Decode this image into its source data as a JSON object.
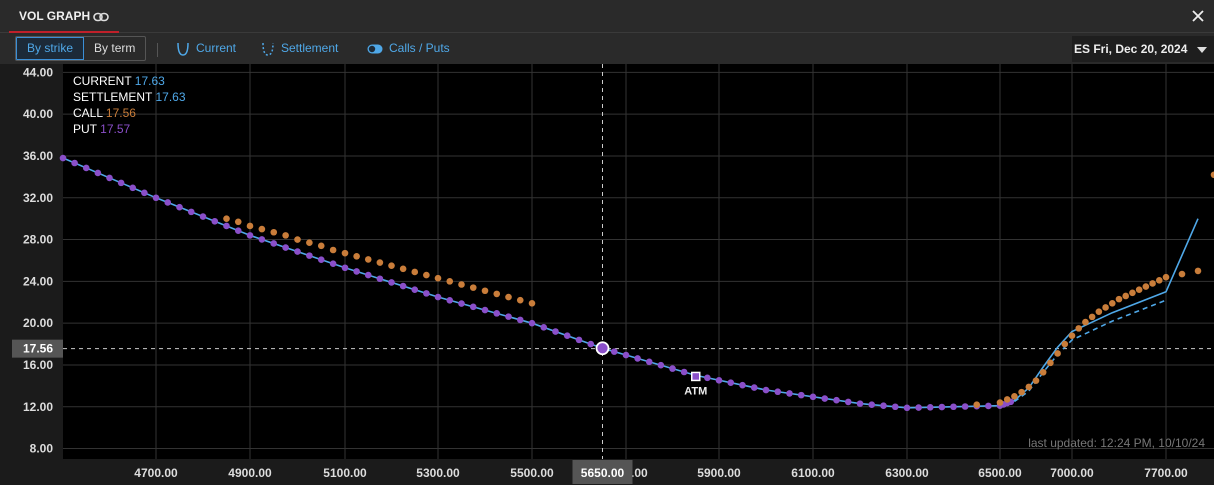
{
  "window": {
    "title": "VOL GRAPH"
  },
  "toolbar": {
    "by_strike": "By strike",
    "by_term": "By term",
    "current": "Current",
    "settlement": "Settlement",
    "calls_puts": "Calls / Puts",
    "expiry": "ES Fri, Dec 20, 2024"
  },
  "legend": {
    "current_label": "CURRENT",
    "current_value": "17.63",
    "settlement_label": "SETTLEMENT",
    "settlement_value": "17.63",
    "call_label": "CALL",
    "call_value": "17.56",
    "put_label": "PUT",
    "put_value": "17.57"
  },
  "footer": {
    "last_updated": "last updated: 12:24 PM, 10/10/24"
  },
  "colors": {
    "current": "#4fa8e8",
    "settlement": "#4fa8e8",
    "call": "#c97d3a",
    "put": "#8a4fc9",
    "background": "#000000",
    "grid": "#333333"
  },
  "chart_data": {
    "type": "line",
    "xlim": [
      4500,
      7850
    ],
    "ylim": [
      7.0,
      44.8
    ],
    "x_ticks": [
      4700,
      4900,
      5100,
      5300,
      5500,
      5700,
      5900,
      6100,
      6300,
      6500,
      7000,
      7700
    ],
    "x_tick_labels": [
      "4700.00",
      "4900.00",
      "5100.00",
      "5300.00",
      "5500.00",
      "5700.00",
      "5900.00",
      "6100.00",
      "6300.00",
      "6500.00",
      "7000.00",
      "7700.00"
    ],
    "y_ticks": [
      8,
      12,
      16,
      20,
      24,
      28,
      32,
      36,
      40,
      44
    ],
    "y_tick_labels": [
      "8.00",
      "12.00",
      "16.00",
      "20.00",
      "24.00",
      "28.00",
      "32.00",
      "36.00",
      "40.00",
      "44.00"
    ],
    "crosshair": {
      "x": 5650,
      "y": 17.56,
      "x_label": "5650.00",
      "y_label": "17.56"
    },
    "atm": {
      "x": 5850,
      "y": 14.9,
      "label": "ATM"
    },
    "series": [
      {
        "name": "CURRENT",
        "type": "line",
        "color": "#4fa8e8",
        "points": [
          [
            4500,
            35.8
          ],
          [
            4700,
            32.0
          ],
          [
            4900,
            28.4
          ],
          [
            5100,
            25.3
          ],
          [
            5300,
            22.5
          ],
          [
            5500,
            20.0
          ],
          [
            5650,
            17.6
          ],
          [
            5850,
            15.0
          ],
          [
            6000,
            13.6
          ],
          [
            6200,
            12.3
          ],
          [
            6300,
            11.9
          ],
          [
            6500,
            12.1
          ],
          [
            6600,
            12.6
          ],
          [
            6700,
            13.8
          ],
          [
            6800,
            15.8
          ],
          [
            6900,
            17.7
          ],
          [
            7000,
            19.2
          ],
          [
            7300,
            21.0
          ],
          [
            7700,
            23.0
          ],
          [
            7800,
            30.0
          ]
        ]
      },
      {
        "name": "SETTLEMENT",
        "type": "dashed",
        "color": "#4fa8e8",
        "points": [
          [
            6600,
            12.5
          ],
          [
            6700,
            13.5
          ],
          [
            6800,
            15.3
          ],
          [
            6900,
            17.0
          ],
          [
            7000,
            18.4
          ],
          [
            7300,
            20.2
          ],
          [
            7700,
            22.2
          ]
        ]
      },
      {
        "name": "PUT",
        "type": "points",
        "color": "#8a4fc9",
        "x_start": 4500,
        "x_end": 6575,
        "step": 25,
        "note_values_follow_current": true
      },
      {
        "name": "CALL",
        "type": "points",
        "color": "#c97d3a",
        "points": [
          [
            4850,
            30.0
          ],
          [
            4875,
            29.7
          ],
          [
            4900,
            29.3
          ],
          [
            4925,
            29.0
          ],
          [
            4950,
            28.7
          ],
          [
            4975,
            28.4
          ],
          [
            5000,
            28.0
          ],
          [
            5025,
            27.7
          ],
          [
            5050,
            27.4
          ],
          [
            5075,
            27.0
          ],
          [
            5100,
            26.7
          ],
          [
            5125,
            26.4
          ],
          [
            5150,
            26.1
          ],
          [
            5175,
            25.8
          ],
          [
            5200,
            25.5
          ],
          [
            5225,
            25.2
          ],
          [
            5250,
            24.9
          ],
          [
            5275,
            24.6
          ],
          [
            5300,
            24.3
          ],
          [
            5325,
            24.0
          ],
          [
            5350,
            23.7
          ],
          [
            5375,
            23.4
          ],
          [
            5400,
            23.1
          ],
          [
            5425,
            22.8
          ],
          [
            5450,
            22.5
          ],
          [
            5475,
            22.2
          ],
          [
            5500,
            21.9
          ],
          [
            6450,
            12.2
          ],
          [
            6500,
            12.4
          ],
          [
            6550,
            12.7
          ],
          [
            6600,
            13.0
          ],
          [
            6650,
            13.4
          ],
          [
            6700,
            13.9
          ],
          [
            6750,
            14.5
          ],
          [
            6800,
            15.3
          ],
          [
            6850,
            16.2
          ],
          [
            6900,
            17.1
          ],
          [
            6950,
            18.0
          ],
          [
            7000,
            18.8
          ],
          [
            7050,
            19.5
          ],
          [
            7100,
            20.1
          ],
          [
            7150,
            20.6
          ],
          [
            7200,
            21.1
          ],
          [
            7250,
            21.5
          ],
          [
            7300,
            21.9
          ],
          [
            7350,
            22.3
          ],
          [
            7400,
            22.6
          ],
          [
            7450,
            22.9
          ],
          [
            7500,
            23.2
          ],
          [
            7550,
            23.5
          ],
          [
            7600,
            23.8
          ],
          [
            7650,
            24.1
          ],
          [
            7700,
            24.4
          ],
          [
            7750,
            24.7
          ],
          [
            7800,
            25.0
          ],
          [
            7850,
            34.2
          ]
        ]
      }
    ],
    "marker_current": {
      "x": 5650,
      "y": 17.6
    }
  }
}
